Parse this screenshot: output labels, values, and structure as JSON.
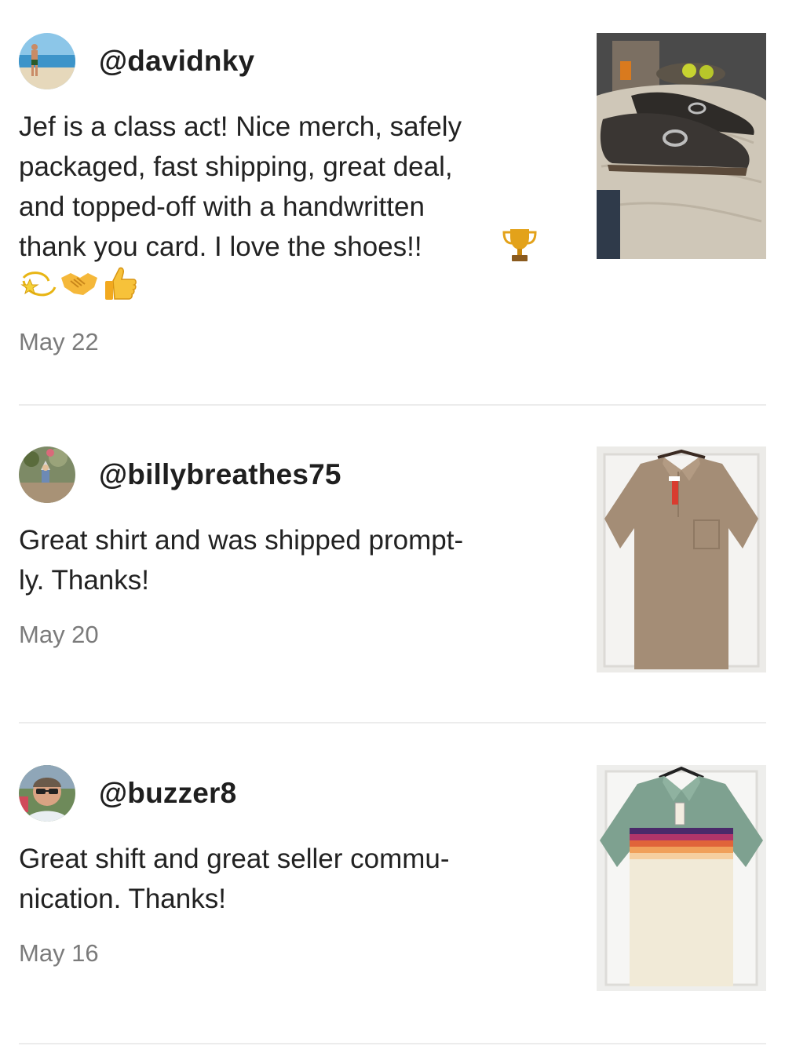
{
  "reviews": [
    {
      "username": "@davidnky",
      "text": "Jef is a class act! Nice merch, safely\npackaged, fast shipping, great deal,\nand topped-off with a handwritten\nthank you card. I love the shoes!!",
      "emojis": [
        "trophy-icon",
        "dizzy-icon",
        "handshake-icon",
        "thumbs-up-icon"
      ],
      "date": "May 22",
      "photo": "loafer-shoes-photo"
    },
    {
      "username": "@billybreathes75",
      "text": "Great shirt and was shipped prompt-\nly. Thanks!",
      "date": "May 20",
      "photo": "tan-polo-shirt-photo"
    },
    {
      "username": "@buzzer8",
      "text": "Great shift and great seller commu-\nnication. Thanks!",
      "date": "May 16",
      "photo": "striped-polo-shirt-photo"
    }
  ],
  "colors": {
    "text": "#222222",
    "date": "#7b7b7b",
    "divider": "#ececec"
  }
}
